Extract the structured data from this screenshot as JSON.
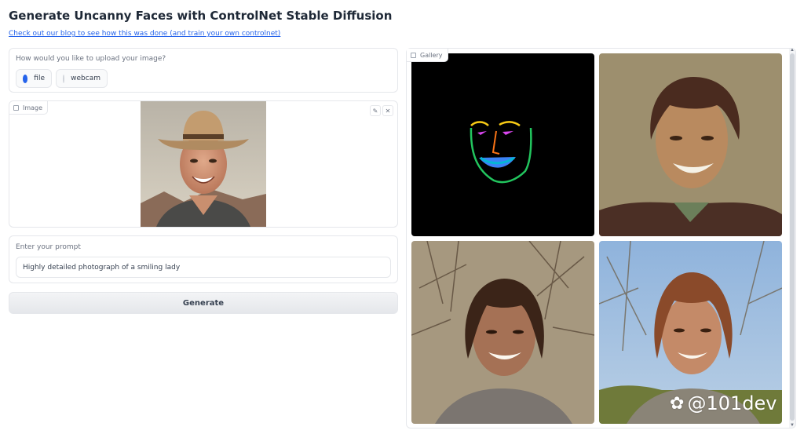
{
  "header": {
    "title": "Generate Uncanny Faces with ControlNet Stable Diffusion",
    "blog_link": "Check out our blog to see how this was done (and train your own controlnet)"
  },
  "upload": {
    "question": "How would you like to upload your image?",
    "options": [
      {
        "label": "file",
        "selected": true
      },
      {
        "label": "webcam",
        "selected": false
      }
    ]
  },
  "image_input": {
    "tag": "Image",
    "edit_icon": "pencil-icon",
    "clear_icon": "close-icon",
    "clear_glyph": "✕",
    "edit_glyph": "✎"
  },
  "prompt": {
    "label": "Enter your prompt",
    "value": "Highly detailed photograph of a smiling lady"
  },
  "generate": {
    "label": "Generate"
  },
  "gallery": {
    "tag": "Gallery",
    "items": [
      {
        "description": "control-landmarks-image"
      },
      {
        "description": "generated-face-1"
      },
      {
        "description": "generated-face-2"
      },
      {
        "description": "generated-face-3"
      }
    ]
  },
  "watermark": {
    "text": "@101dev"
  },
  "colors": {
    "accent": "#2563eb",
    "border": "#e5e7eb"
  }
}
